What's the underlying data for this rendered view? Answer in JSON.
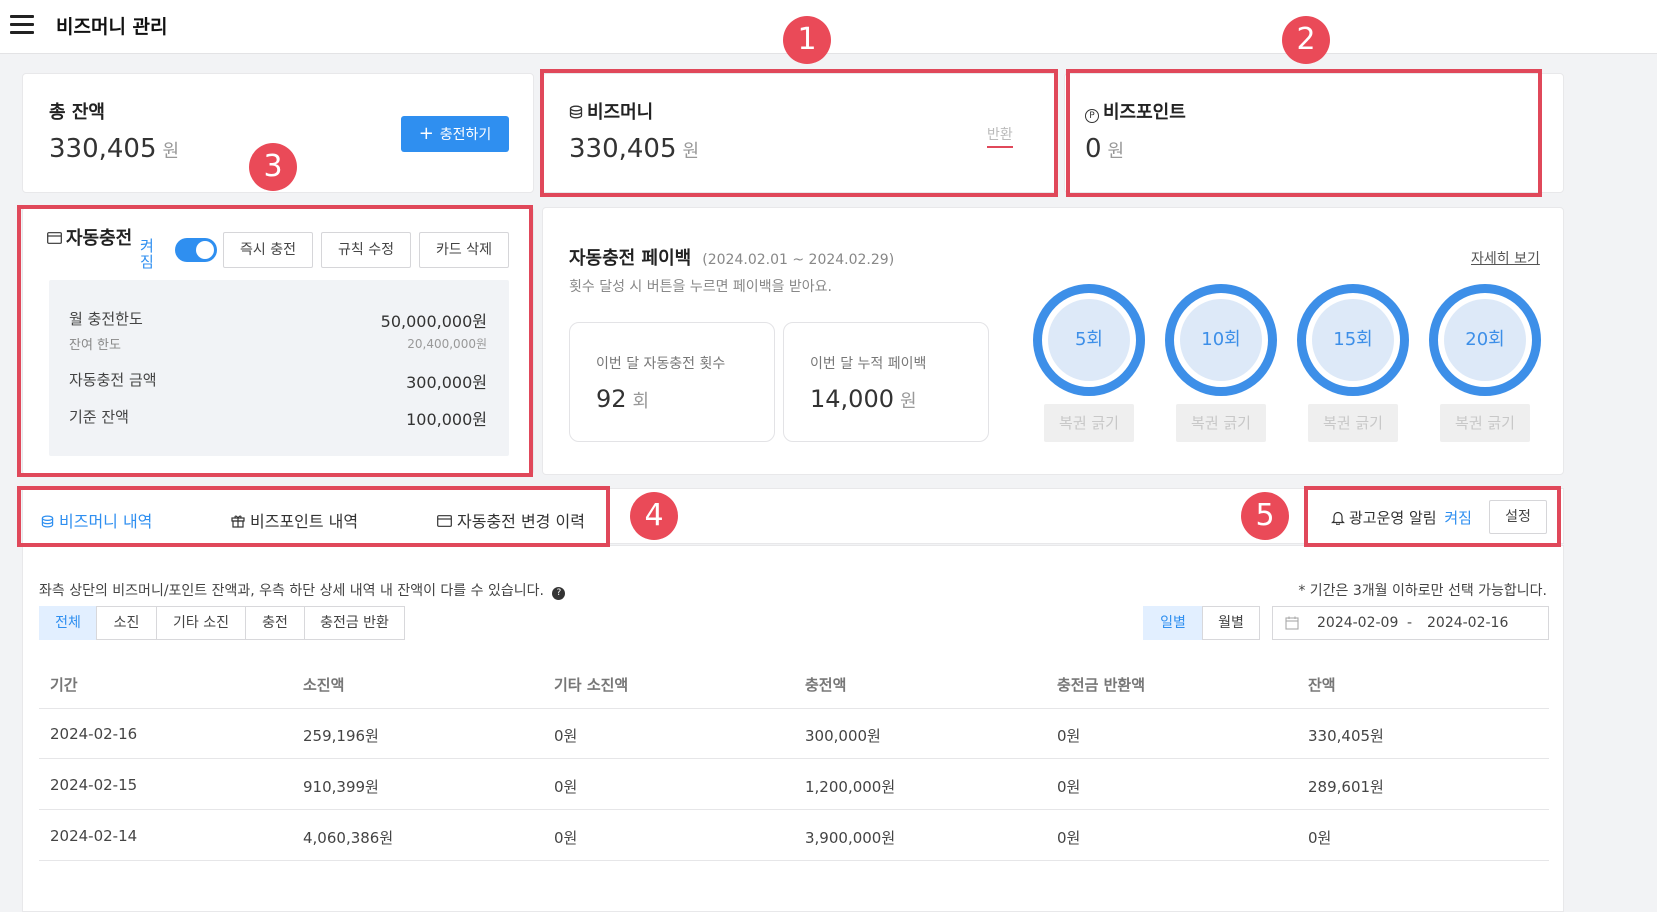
{
  "app": {
    "title": "비즈머니 관리",
    "menu_icon": "hamburger-menu-icon"
  },
  "total": {
    "label": "총 잔액",
    "amount": "330,405",
    "unit": "원",
    "charge_button": "충전하기",
    "charge_icon": "plus-icon"
  },
  "bizmoney": {
    "label": "비즈머니",
    "amount": "330,405",
    "unit": "원",
    "refund_link": "반환",
    "icon": "coin-stack-icon"
  },
  "bizpoint": {
    "label": "비즈포인트",
    "amount": "0",
    "unit": "원",
    "icon": "p-circle-icon"
  },
  "markers": [
    "1",
    "2",
    "3",
    "4",
    "5"
  ],
  "autocharge": {
    "title": "자동충전",
    "status": "켜짐",
    "toggle_on": true,
    "buttons": {
      "instant": "즉시 충전",
      "edit_rule": "규칙 수정",
      "delete_card": "카드 삭제"
    },
    "rows": {
      "monthly_limit_label": "월 충전한도",
      "monthly_limit_value": "50,000,000원",
      "remaining_label": "잔여 한도",
      "remaining_value": "20,400,000원",
      "amount_label": "자동충전 금액",
      "amount_value": "300,000원",
      "base_label": "기준 잔액",
      "base_value": "100,000원"
    }
  },
  "payback": {
    "title": "자동충전 페이백",
    "period": "(2024.02.01 ~ 2024.02.29)",
    "desc": "횟수 달성 시 버튼을 누르면 페이백을 받아요.",
    "detail_link": "자세히 보기",
    "count_label": "이번 달 자동충전 횟수",
    "count_value": "92",
    "count_unit": "회",
    "payback_label": "이번 달 누적 페이백",
    "payback_value": "14,000",
    "payback_unit": "원",
    "milestones": [
      {
        "label": "5회",
        "button": "복권 긁기"
      },
      {
        "label": "10회",
        "button": "복권 긁기"
      },
      {
        "label": "15회",
        "button": "복권 긁기"
      },
      {
        "label": "20회",
        "button": "복권 긁기"
      }
    ]
  },
  "tabs": [
    {
      "label": "비즈머니 내역",
      "icon": "coin-stack-icon",
      "active": true
    },
    {
      "label": "비즈포인트 내역",
      "icon": "gift-icon",
      "active": false
    },
    {
      "label": "자동충전 변경 이력",
      "icon": "card-icon",
      "active": false
    }
  ],
  "alert": {
    "label": "광고운영 알림",
    "status": "켜짐",
    "settings_button": "설정",
    "icon": "bell-icon"
  },
  "history": {
    "notice": "좌측 상단의 비즈머니/포인트 잔액과, 우측 하단 상세 내역 내 잔액이 다를 수 있습니다.",
    "period_note": "* 기간은 3개월 이하로만 선택 가능합니다.",
    "filters": [
      "전체",
      "소진",
      "기타 소진",
      "충전",
      "충전금 반환"
    ],
    "view_modes": [
      "일별",
      "월별"
    ],
    "date_from": "2024-02-09",
    "date_to": "2024-02-16",
    "date_sep": "-",
    "columns": [
      "기간",
      "소진액",
      "기타 소진액",
      "충전액",
      "충전금 반환액",
      "잔액"
    ],
    "rows": [
      [
        "2024-02-16",
        "259,196원",
        "0원",
        "300,000원",
        "0원",
        "330,405원"
      ],
      [
        "2024-02-15",
        "910,399원",
        "0원",
        "1,200,000원",
        "0원",
        "289,601원"
      ],
      [
        "2024-02-14",
        "4,060,386원",
        "0원",
        "3,900,000원",
        "0원",
        "0원"
      ]
    ]
  }
}
